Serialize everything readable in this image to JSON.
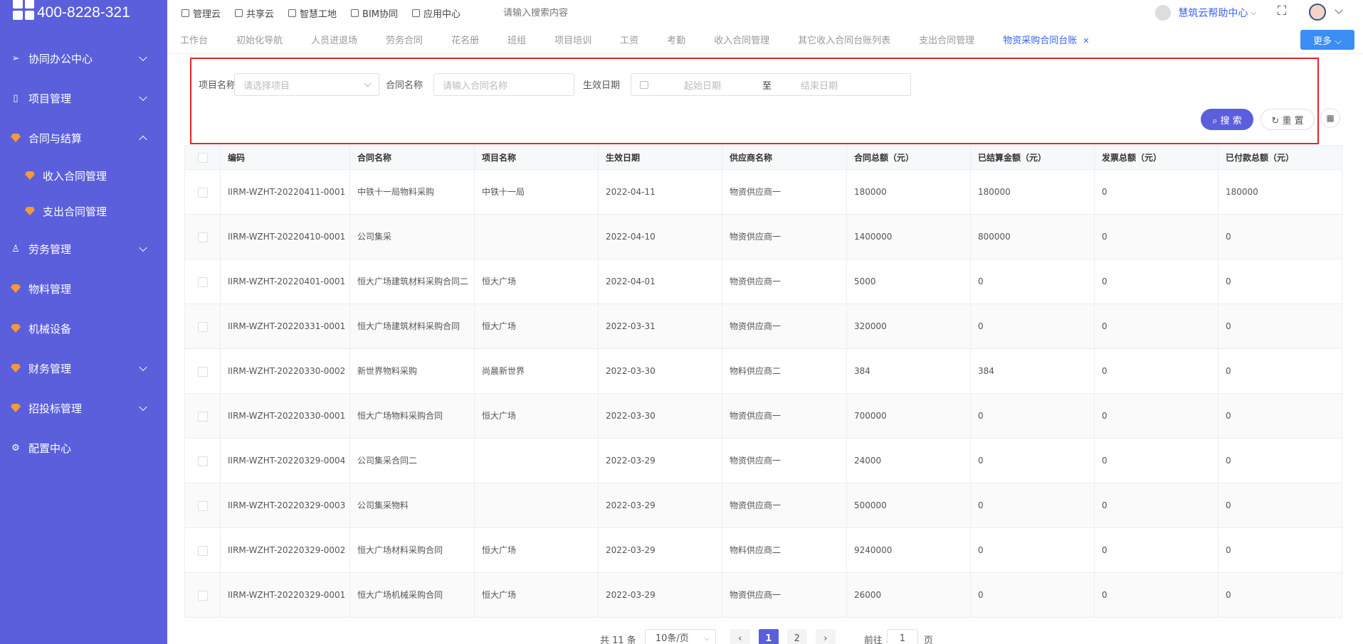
{
  "brand": {
    "phone": "400-8228-321"
  },
  "sidebar": {
    "items": [
      {
        "label": "协同办公中心",
        "icon": "send-icon",
        "chev": "down"
      },
      {
        "label": "项目管理",
        "icon": "book-icon",
        "chev": "down"
      },
      {
        "label": "合同与结算",
        "icon": "gem-icon",
        "chev": "up"
      },
      {
        "label": "收入合同管理",
        "icon": "gem-icon",
        "sub": true
      },
      {
        "label": "支出合同管理",
        "icon": "gem-icon",
        "sub": true
      },
      {
        "label": "劳务管理",
        "icon": "user-icon",
        "chev": "down"
      },
      {
        "label": "物料管理",
        "icon": "gem-icon"
      },
      {
        "label": "机械设备",
        "icon": "gem-icon"
      },
      {
        "label": "财务管理",
        "icon": "gem-icon",
        "chev": "down"
      },
      {
        "label": "招投标管理",
        "icon": "gem-icon",
        "chev": "down"
      },
      {
        "label": "配置中心",
        "icon": "gear-icon"
      }
    ]
  },
  "topbar": {
    "links": [
      "管理云",
      "共享云",
      "智慧工地",
      "BIM协同",
      "应用中心"
    ],
    "search_placeholder": "请输入搜索内容",
    "help": "慧筑云帮助中心"
  },
  "tabs": {
    "items": [
      "工作台",
      "初始化导航",
      "人员进退场",
      "劳务合同",
      "花名册",
      "班组",
      "项目培训",
      "工资",
      "考勤",
      "收入合同管理",
      "其它收入合同台账列表",
      "支出合同管理",
      "物资采购合同台账"
    ],
    "active_index": 12,
    "more": "更多"
  },
  "filter": {
    "project_label": "项目名称",
    "project_placeholder": "请选择项目",
    "contract_label": "合同名称",
    "contract_placeholder": "请输入合同名称",
    "date_label": "生效日期",
    "start_placeholder": "起始日期",
    "to": "至",
    "end_placeholder": "结束日期",
    "search": "搜 索",
    "reset": "重 置"
  },
  "table": {
    "columns": [
      "编码",
      "合同名称",
      "项目名称",
      "生效日期",
      "供应商名称",
      "合同总额（元）",
      "已结算金额（元）",
      "发票总额（元）",
      "已付款总额（元）"
    ],
    "rows": [
      [
        "IIRM-WZHT-20220411-0001",
        "中铁十一局物料采购",
        "中铁十一局",
        "2022-04-11",
        "物资供应商一",
        "180000",
        "180000",
        "0",
        "180000"
      ],
      [
        "IIRM-WZHT-20220410-0001",
        "公司集采",
        "",
        "2022-04-10",
        "物资供应商一",
        "1400000",
        "800000",
        "0",
        "0"
      ],
      [
        "IIRM-WZHT-20220401-0001",
        "恒大广场建筑材料采购合同二",
        "恒大广场",
        "2022-04-01",
        "物资供应商一",
        "5000",
        "0",
        "0",
        "0"
      ],
      [
        "IIRM-WZHT-20220331-0001",
        "恒大广场建筑材料采购合同",
        "恒大广场",
        "2022-03-31",
        "物资供应商一",
        "320000",
        "0",
        "0",
        "0"
      ],
      [
        "IIRM-WZHT-20220330-0002",
        "新世界物料采购",
        "尚晨新世界",
        "2022-03-30",
        "物料供应商二",
        "384",
        "384",
        "0",
        "0"
      ],
      [
        "IIRM-WZHT-20220330-0001",
        "恒大广场物料采购合同",
        "恒大广场",
        "2022-03-30",
        "物资供应商一",
        "700000",
        "0",
        "0",
        "0"
      ],
      [
        "IIRM-WZHT-20220329-0004",
        "公司集采合同二",
        "",
        "2022-03-29",
        "物资供应商一",
        "24000",
        "0",
        "0",
        "0"
      ],
      [
        "IIRM-WZHT-20220329-0003",
        "公司集采物料",
        "",
        "2022-03-29",
        "物资供应商一",
        "500000",
        "0",
        "0",
        "0"
      ],
      [
        "IIRM-WZHT-20220329-0002",
        "恒大广场材料采购合同",
        "恒大广场",
        "2022-03-29",
        "物料供应商二",
        "9240000",
        "0",
        "0",
        "0"
      ],
      [
        "IIRM-WZHT-20220329-0001",
        "恒大广场机械采购合同",
        "恒大广场",
        "2022-03-29",
        "物资供应商一",
        "26000",
        "0",
        "0",
        "0"
      ]
    ]
  },
  "pager": {
    "total": "共 11 条",
    "size": "10条/页",
    "prev": "‹",
    "pages": [
      "1",
      "2"
    ],
    "current_page": "1",
    "next": "›",
    "goto_label": "前往",
    "goto_value": "1",
    "page_suffix": "页"
  }
}
